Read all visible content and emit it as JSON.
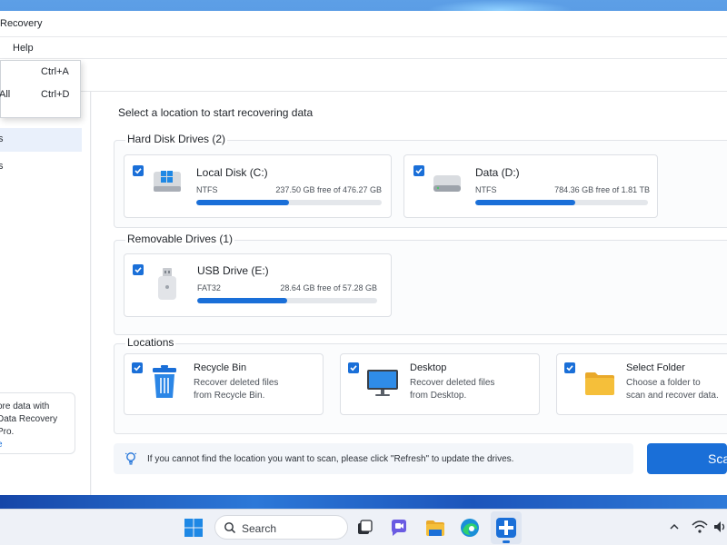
{
  "window": {
    "title": "Recovery",
    "menu_help": "Help"
  },
  "dropdown": {
    "items": [
      {
        "label": "",
        "shortcut": "Ctrl+A"
      },
      {
        "label": "All",
        "shortcut": "Ctrl+D"
      }
    ]
  },
  "sidebar": {
    "items": [
      {
        "label": "s",
        "active": true
      },
      {
        "label": "s",
        "active": false
      }
    ],
    "promo": {
      "line1": "ore data with",
      "line2": "Data Recovery Pro.",
      "link": "e"
    }
  },
  "main": {
    "title": "Select  a location to start recovering data",
    "hard_disks": {
      "title": "Hard Disk Drives (2)",
      "drives": [
        {
          "name": "Local Disk (C:)",
          "fs": "NTFS",
          "free": "237.50 GB free of 476.27 GB",
          "used_fraction": 0.5,
          "icon": "windows-drive-icon",
          "checked": true
        },
        {
          "name": "Data (D:)",
          "fs": "NTFS",
          "free": "784.36 GB free of 1.81 TB",
          "used_fraction": 0.58,
          "icon": "hard-drive-icon",
          "checked": true
        }
      ]
    },
    "removable": {
      "title": "Removable Drives (1)",
      "drives": [
        {
          "name": "USB Drive (E:)",
          "fs": "FAT32",
          "free": "28.64 GB free of 57.28 GB",
          "used_fraction": 0.5,
          "icon": "usb-drive-icon",
          "checked": true
        }
      ]
    },
    "locations": {
      "title": "Locations",
      "items": [
        {
          "name": "Recycle Bin",
          "desc1": "Recover deleted files",
          "desc2": "from Recycle Bin.",
          "icon": "recycle-bin-icon",
          "checked": true
        },
        {
          "name": "Desktop",
          "desc1": "Recover deleted files",
          "desc2": "from Desktop.",
          "icon": "desktop-icon",
          "checked": true
        },
        {
          "name": "Select Folder",
          "desc1": "Choose a folder to",
          "desc2": "scan and recover data.",
          "icon": "folder-icon",
          "checked": true
        }
      ]
    },
    "hint": "If you cannot find the location you want to scan, please click \"Refresh\" to update the drives.",
    "scan_label": "Sca"
  },
  "taskbar": {
    "search_label": "Search",
    "icons": [
      "windows-start-icon",
      "search-icon",
      "task-view-icon",
      "chat-icon",
      "file-explorer-icon",
      "edge-icon",
      "data-recovery-app-icon",
      "chevron-up-icon",
      "wifi-icon",
      "volume-icon"
    ]
  },
  "colors": {
    "accent": "#1a6fd8",
    "progress_track": "#e4e7eb",
    "folder_yellow": "#f5bf3a"
  }
}
